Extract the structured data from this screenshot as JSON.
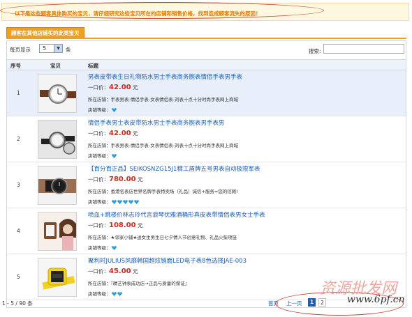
{
  "notice": {
    "text": "以下是这些顾客具体购买的宝贝，请仔细研究这些宝贝所在的店铺和销售价格，找到造成顾客流失的原因！"
  },
  "tab": {
    "label": "顾客在其他店铺买的此类宝贝"
  },
  "toolbar": {
    "per_page_label": "每页显示",
    "per_page_value": "5",
    "per_page_unit": "条",
    "search_label": "搜索:",
    "search_value": ""
  },
  "table": {
    "headers": [
      "序号",
      "宝贝",
      "标题"
    ],
    "rows": [
      {
        "index": "1",
        "title": "男表皮带表生日礼物防水男士手表商务腕表情侣手表男手表",
        "price_label": "一口价：",
        "price": "42.00",
        "price_unit": "元",
        "shop_label": "所在店铺：",
        "shop": "手表男表-情侣手表-女表情侣表-刘表十点十分时尚手表网上商城",
        "level_label": "店铺等级：",
        "level_count": 1,
        "level_color": "#2a9bd8",
        "highlight": true
      },
      {
        "index": "2",
        "title": "情侣手表男士表皮带防水男士手表商务腕表男手表男",
        "price_label": "一口价：",
        "price": "42.00",
        "price_unit": "元",
        "shop_label": "所在店铺：",
        "shop": "手表男表-情侣手表-女表情侣表-刘表十点十分时尚手表网上商城",
        "level_label": "店铺等级：",
        "level_count": 1,
        "level_color": "#2a9bd8",
        "highlight": false
      },
      {
        "index": "3",
        "title": "【百分百正品】SEIKOSNZG15J1精工盾牌五号男表自动极限军表",
        "price_label": "一口价：",
        "price": "780.00",
        "price_unit": "元",
        "shop_label": "所在店铺：",
        "shop": "香港名表店世界名牌手表特卖场（礼品）诚信+服务=您的信赖!",
        "level_label": "店铺等级：",
        "level_count": 5,
        "level_color": "#2a9bd8",
        "highlight": false
      },
      {
        "index": "4",
        "title": "喷血+跳楼价林志玲代言浪琴优雅酒桶形真皮表带情侣表男女士手表",
        "price_label": "一口价：",
        "price": "108.00",
        "price_unit": "元",
        "shop_label": "所在店铺：",
        "shop": "★邻家小铺★送女生男生日七夕情人节创意礼物、礼品火柴项链",
        "level_label": "店铺等级：",
        "level_count": 1,
        "level_color": "#2a9bd8",
        "highlight": false
      },
      {
        "index": "5",
        "title": "聚利时JULIUS风靡韩国超炫镜面LED电子表8色选择JAE-003",
        "price_label": "一口价：",
        "price": "45.00",
        "price_unit": "元",
        "shop_label": "所在店铺：",
        "shop": "『精艺钟表成功店→正品与质量的保证』",
        "level_label": "店铺等级：",
        "level_count": 2,
        "level_color": "#2a9bd8",
        "highlight": false
      }
    ]
  },
  "pager": {
    "info": "1 - 5 / 90 条",
    "first": "首页",
    "prev": "上一页",
    "pages": [
      "1",
      "2"
    ],
    "current": "1"
  },
  "watermark": {
    "line1": "资源批发网",
    "line2": "www.6pf.cn"
  }
}
